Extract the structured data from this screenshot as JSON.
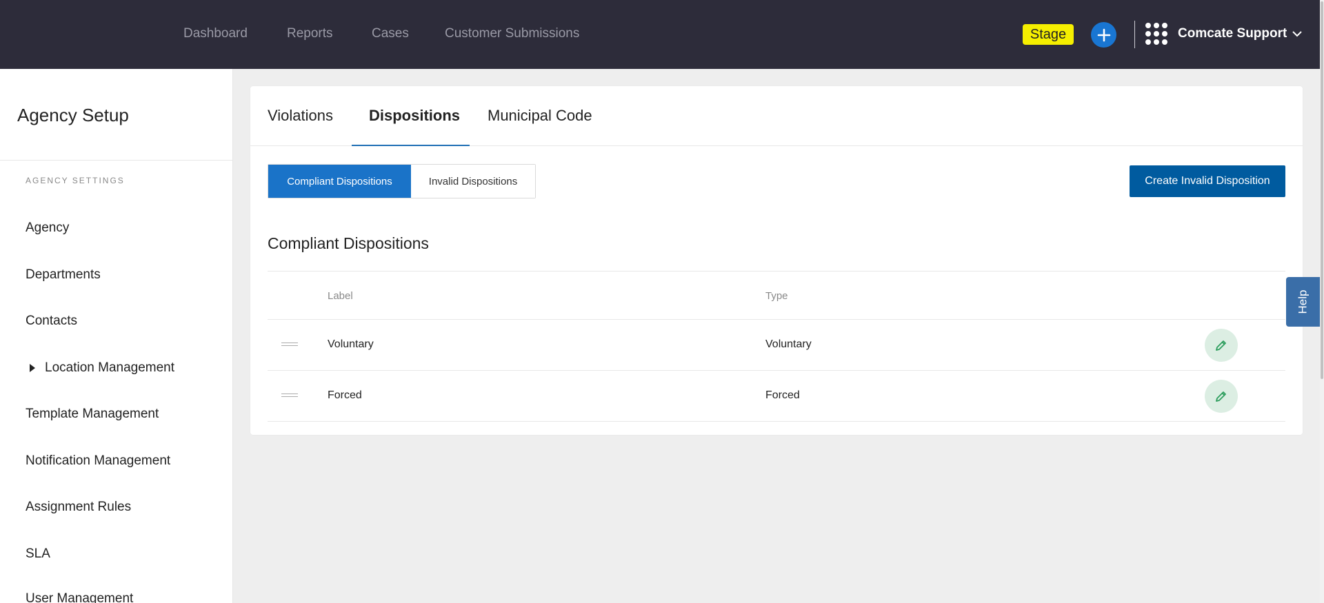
{
  "topbar": {
    "nav": [
      "Dashboard",
      "Reports",
      "Cases",
      "Customer Submissions"
    ],
    "stage_label": "Stage",
    "user_label": "Comcate Support"
  },
  "sidebar": {
    "title": "Agency Setup",
    "section_label": "AGENCY SETTINGS",
    "items": [
      "Agency",
      "Departments",
      "Contacts",
      "Location Management",
      "Template Management",
      "Notification Management",
      "Assignment Rules",
      "SLA",
      "User Management"
    ]
  },
  "main": {
    "tabs": [
      "Violations",
      "Dispositions",
      "Municipal Code"
    ],
    "active_tab": "Dispositions",
    "segments": [
      "Compliant Dispositions",
      "Invalid Dispositions"
    ],
    "active_segment": "Compliant Dispositions",
    "create_button": "Create Invalid Disposition",
    "section_title": "Compliant Dispositions",
    "table": {
      "columns": [
        "Label",
        "Type"
      ],
      "rows": [
        {
          "label": "Voluntary",
          "type": "Voluntary"
        },
        {
          "label": "Forced",
          "type": "Forced"
        }
      ]
    }
  },
  "help_label": "Help",
  "colors": {
    "topbar_bg": "#2d2c3a",
    "accent": "#1a73c8",
    "create_btn": "#005b9f",
    "stage_badge": "#f5ef00",
    "edit_btn_bg": "#dceee3",
    "edit_icon": "#2e9e5e"
  },
  "icons": {
    "add": "plus-icon",
    "apps": "apps-grid-icon",
    "user_menu": "chevron-down-icon",
    "tree_toggle": "caret-right-icon",
    "row_drag": "drag-handle-icon",
    "row_edit": "pencil-icon"
  }
}
